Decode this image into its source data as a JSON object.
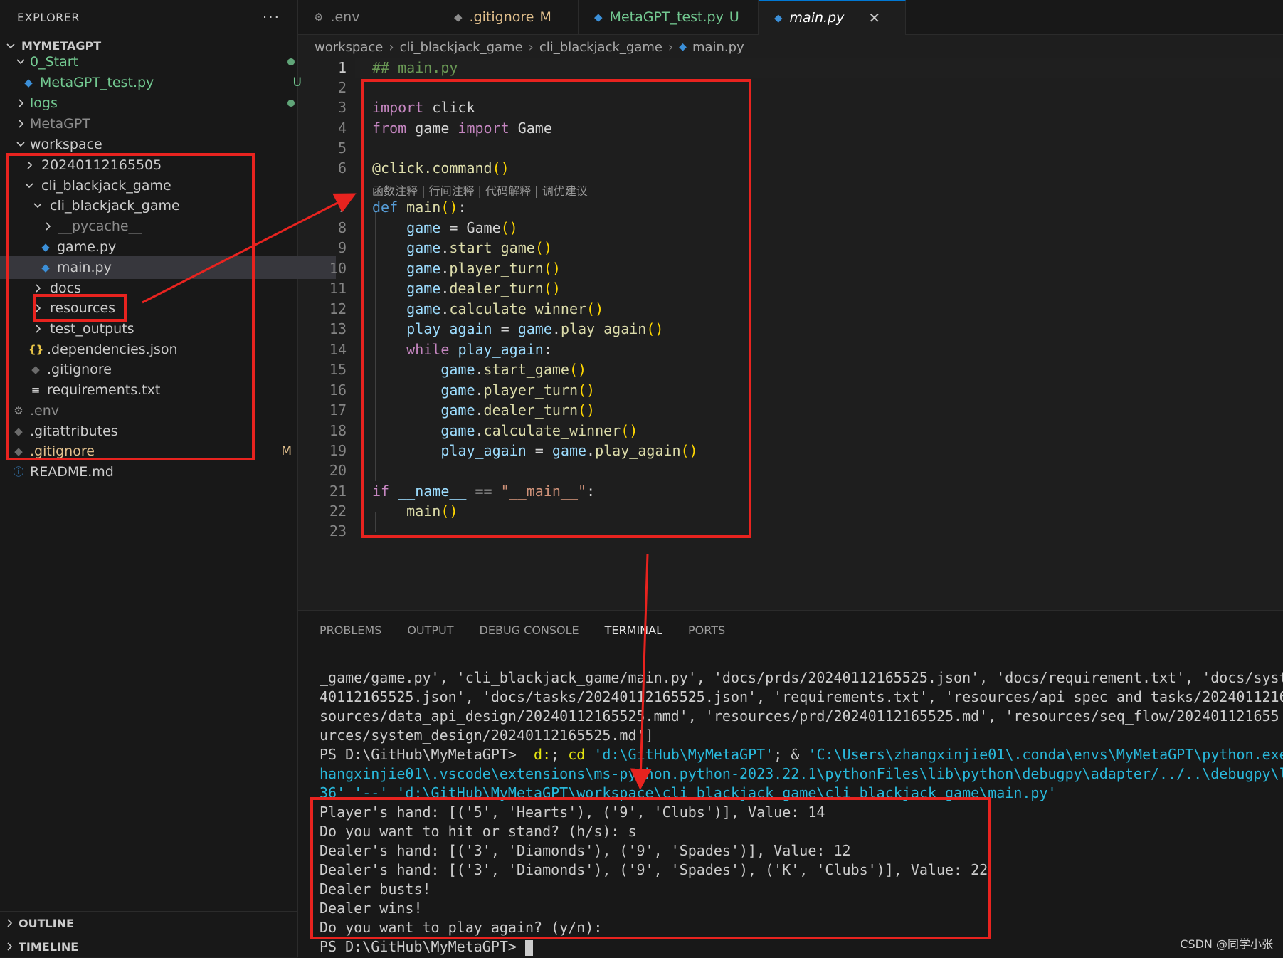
{
  "sidebar": {
    "title": "EXPLORER",
    "more": "···",
    "project": "MYMETAGPT",
    "items": [
      {
        "label": "0_Start",
        "badge": "",
        "dot": true
      },
      {
        "label": "MetaGPT_test.py",
        "badge": "U"
      },
      {
        "label": "logs",
        "dot": true
      },
      {
        "label": "MetaGPT"
      },
      {
        "label": "workspace"
      },
      {
        "label": "20240112165505"
      },
      {
        "label": "cli_blackjack_game"
      },
      {
        "label": "cli_blackjack_game"
      },
      {
        "label": "__pycache__"
      },
      {
        "label": "game.py"
      },
      {
        "label": "main.py"
      },
      {
        "label": "docs"
      },
      {
        "label": "resources"
      },
      {
        "label": "test_outputs"
      },
      {
        "label": ".dependencies.json"
      },
      {
        "label": ".gitignore"
      },
      {
        "label": "requirements.txt"
      },
      {
        "label": ".env"
      },
      {
        "label": ".gitattributes"
      },
      {
        "label": ".gitignore",
        "badge": "M"
      },
      {
        "label": "README.md"
      }
    ],
    "outline": "OUTLINE",
    "timeline": "TIMELINE"
  },
  "tabs": [
    {
      "label": ".env",
      "status": ""
    },
    {
      "label": ".gitignore",
      "status": "M"
    },
    {
      "label": "MetaGPT_test.py",
      "status": "U"
    },
    {
      "label": "main.py",
      "status": "",
      "close": "✕"
    }
  ],
  "breadcrumb": [
    "workspace",
    "cli_blackjack_game",
    "cli_blackjack_game",
    "main.py"
  ],
  "editor": {
    "line_numbers": [
      "1",
      "2",
      "3",
      "4",
      "5",
      "6",
      "7",
      "8",
      "9",
      "10",
      "11",
      "12",
      "13",
      "14",
      "15",
      "16",
      "17",
      "18",
      "19",
      "20",
      "21",
      "22",
      "23"
    ],
    "codelens": "函数注释 | 行间注释 | 代码解释 | 调优建议"
  },
  "panel": {
    "tabs": [
      "PROBLEMS",
      "OUTPUT",
      "DEBUG CONSOLE",
      "TERMINAL",
      "PORTS"
    ],
    "output_lines": [
      "Player's hand: [('5', 'Hearts'), ('9', 'Clubs')], Value: 14",
      "Do you want to hit or stand? (h/s): s",
      "Dealer's hand: [('3', 'Diamonds'), ('9', 'Spades')], Value: 12",
      "Dealer's hand: [('3', 'Diamonds'), ('9', 'Spades'), ('K', 'Clubs')], Value: 22",
      "Dealer busts!",
      "Dealer wins!",
      "Do you want to play again? (y/n):"
    ],
    "prompt": "PS D:\\GitHub\\MyMetaGPT> "
  },
  "watermark": "CSDN @同学小张",
  "colors": {
    "accent": "#0078d4",
    "annotation_red": "#e8231f",
    "git_added": "#73c991",
    "git_modified": "#e2c08d"
  }
}
